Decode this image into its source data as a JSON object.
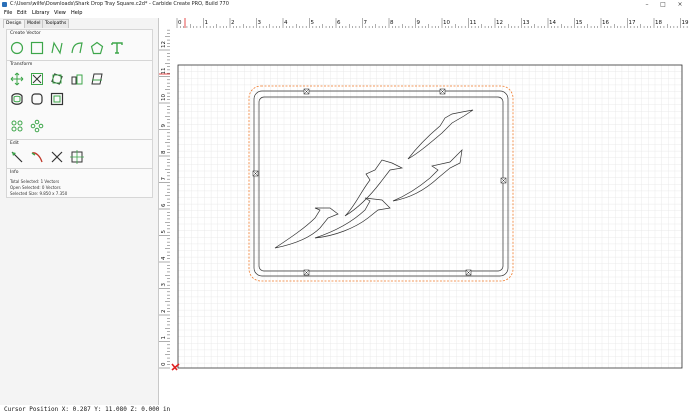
{
  "window": {
    "title": "C:\\Users\\wilfe\\Downloads\\Shark Drop Tray Square.c2d* - Carbide Create PRO, Build 770",
    "controls": [
      "minimize-icon",
      "maximize-icon",
      "close-icon"
    ]
  },
  "menu": [
    "File",
    "Edit",
    "Library",
    "View",
    "Help"
  ],
  "tabs": [
    "Design",
    "Model",
    "Toolpaths"
  ],
  "create_vector": {
    "title": "Create Vector",
    "tools": [
      "circle-icon",
      "rectangle-icon",
      "curve-icon",
      "polyline-icon",
      "polygon-icon",
      "text-icon"
    ]
  },
  "transform": {
    "title": "Transform",
    "tools": [
      "move-icon",
      "scale-icon",
      "rotate-icon",
      "align-icon",
      "mirror-icon",
      "offset-icon",
      "fillet-icon",
      "boundary-icon",
      "node-edit-icon",
      "array-icon"
    ]
  },
  "edit": {
    "title": "Edit",
    "tools": [
      "node-edit-icon",
      "knife-icon",
      "trim-icon",
      "bounding-box-icon"
    ]
  },
  "info": {
    "title": "Info",
    "lines": [
      "Total Selected: 1 Vectors",
      "Open Selected: 0 Vectors",
      "Selected Size: 9.850 x 7.350"
    ]
  },
  "ruler": {
    "x_labels": [
      "0",
      "1",
      "2",
      "3",
      "4",
      "5",
      "6",
      "7",
      "8",
      "9",
      "10",
      "11",
      "12",
      "13",
      "14",
      "15",
      "16",
      "17",
      "18",
      "19"
    ],
    "y_labels": [
      "12",
      "11",
      "10",
      "9",
      "8",
      "7",
      "6",
      "5",
      "4",
      "3",
      "2",
      "1",
      "0"
    ]
  },
  "status": {
    "text": "Cursor Position X: 0.287 Y: 11.080 Z: 0.000 in"
  },
  "colors": {
    "accent": "#3da64a",
    "selection": "#f07a2a",
    "origin": "#e02020"
  }
}
